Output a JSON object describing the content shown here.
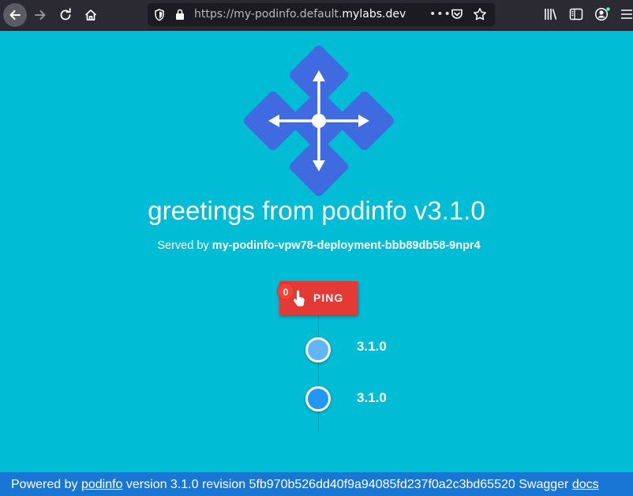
{
  "browser": {
    "url_prefix": "https://my-podinfo.default.",
    "url_domain": "mylabs.dev",
    "more_glyph": "•••"
  },
  "page": {
    "title": "greetings from podinfo v3.1.0",
    "served_prefix": "Served by",
    "served_host": "my-podinfo-vpw78-deployment-bbb89db58-9npr4",
    "ping_label": "PING",
    "ping_count": "0",
    "timeline": [
      {
        "version": "3.1.0",
        "color": "#64b5f6"
      },
      {
        "version": "3.1.0",
        "color": "#2196f3"
      }
    ]
  },
  "footer": {
    "powered_by": "Powered by",
    "podinfo_link": "podinfo",
    "version_text": "version 3.1.0 revision 5fb970b526dd40f9a94085fd237f0a2c3bd65520 Swagger",
    "docs_link": "docs"
  },
  "colors": {
    "background": "#00bcd4",
    "logo": "#3f6ae0",
    "ping_button": "#e53935",
    "footer": "#1976d2"
  },
  "icons": {
    "back": "arrow-left-icon",
    "forward": "arrow-right-icon",
    "reload": "reload-icon",
    "home": "home-icon",
    "shield": "shield-icon",
    "lock": "lock-icon",
    "pocket": "pocket-icon",
    "star": "star-icon",
    "library": "library-icon",
    "sidebar": "sidebar-icon",
    "account": "account-icon",
    "menu": "hamburger-menu-icon",
    "ping": "hand-pointer-icon"
  }
}
